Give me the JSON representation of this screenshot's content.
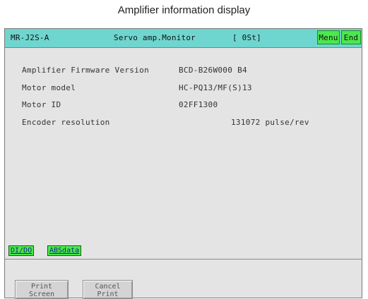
{
  "caption": "Amplifier information display",
  "header": {
    "model": "MR-J2S-A",
    "title": "Servo amp.Monitor",
    "station": "[ 0St]",
    "menu_label": "Menu",
    "end_label": "End"
  },
  "info": {
    "firmware_label": "Amplifier Firmware Version",
    "firmware_value": "BCD-B26W000 B4",
    "motor_model_label": "Motor model",
    "motor_model_value": "HC-PQ13/MF(S)13",
    "motor_id_label": "Motor ID",
    "motor_id_value": "02FF1300",
    "encoder_label": "Encoder resolution",
    "encoder_value": "131072 pulse/rev"
  },
  "links": {
    "dio": "DI/DO",
    "absdata": "ABSdata"
  },
  "buttons": {
    "print_line1": "Print",
    "print_line2": "Screen",
    "cancel_line1": "Cancel",
    "cancel_line2": "Print"
  },
  "colors": {
    "titlebar": "#6fd6cf",
    "button_green": "#4ce84c",
    "screen_bg": "#e4e4e4"
  }
}
